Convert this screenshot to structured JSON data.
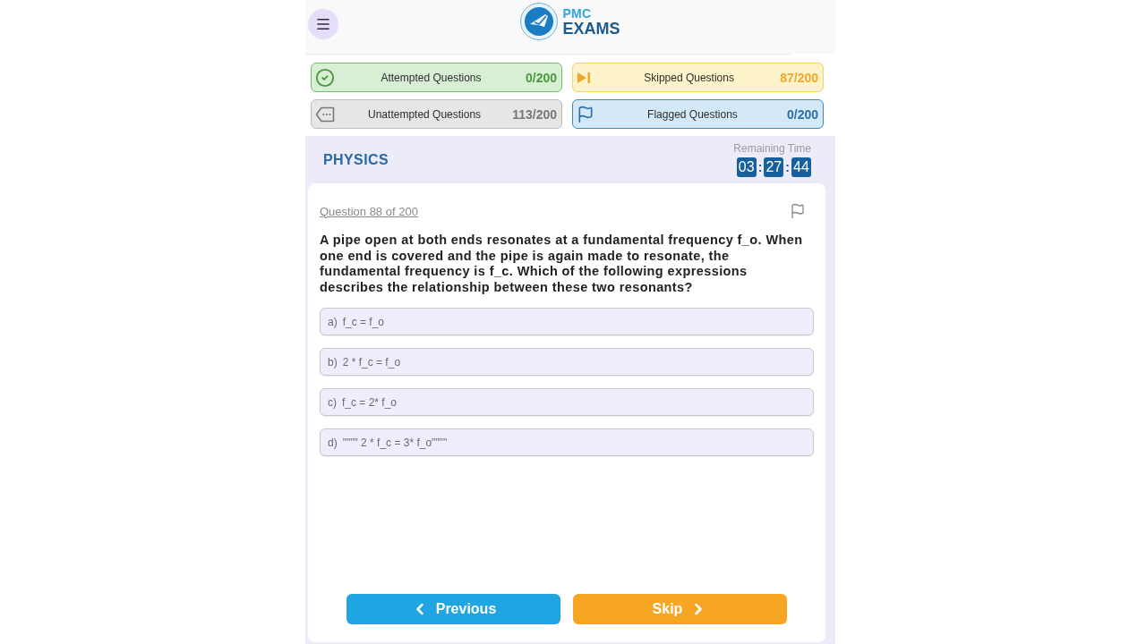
{
  "header": {
    "brand_top": "PMC",
    "brand_bottom": "EXAMS"
  },
  "stats": [
    {
      "kind": "attempted",
      "label": "Attempted Questions",
      "count": "0/200"
    },
    {
      "kind": "skipped",
      "label": "Skipped Questions",
      "count": "87/200"
    },
    {
      "kind": "unattempted",
      "label": "Unattempted Questions",
      "count": "113/200"
    },
    {
      "kind": "flagged",
      "label": "Flagged Questions",
      "count": "0/200"
    }
  ],
  "subject": {
    "title": "PHYSICS"
  },
  "timer": {
    "label": "Remaining Time",
    "segments": [
      {
        "kind": "digits",
        "text": "03"
      },
      {
        "kind": "separator",
        "text": ":"
      },
      {
        "kind": "digits",
        "text": "27"
      },
      {
        "kind": "separator",
        "text": ":"
      },
      {
        "kind": "digits",
        "text": "44"
      }
    ]
  },
  "question": {
    "number_label": "Question 88 of 200",
    "flagged": false,
    "text": "A pipe open at both ends resonates at a fundamental frequency f_o. When one end is covered and the pipe is again made to resonate, the fundamental frequency is f_c. Which of the following expressions describes the relationship between these two resonants?",
    "options": [
      {
        "letter": "a)",
        "text": "f_c = f_o",
        "selected": false
      },
      {
        "letter": "b)",
        "text": "2 * f_c = f_o",
        "selected": false
      },
      {
        "letter": "c)",
        "text": "f_c = 2* f_o",
        "selected": false
      },
      {
        "letter": "d)",
        "text": "\"\"\"\" 2 * f_c = 3* f_o\"\"\"\"",
        "selected": false
      }
    ]
  },
  "buttons": [
    {
      "kind": "previous",
      "label": "Previous"
    },
    {
      "kind": "skip",
      "label": "Skip"
    }
  ]
}
